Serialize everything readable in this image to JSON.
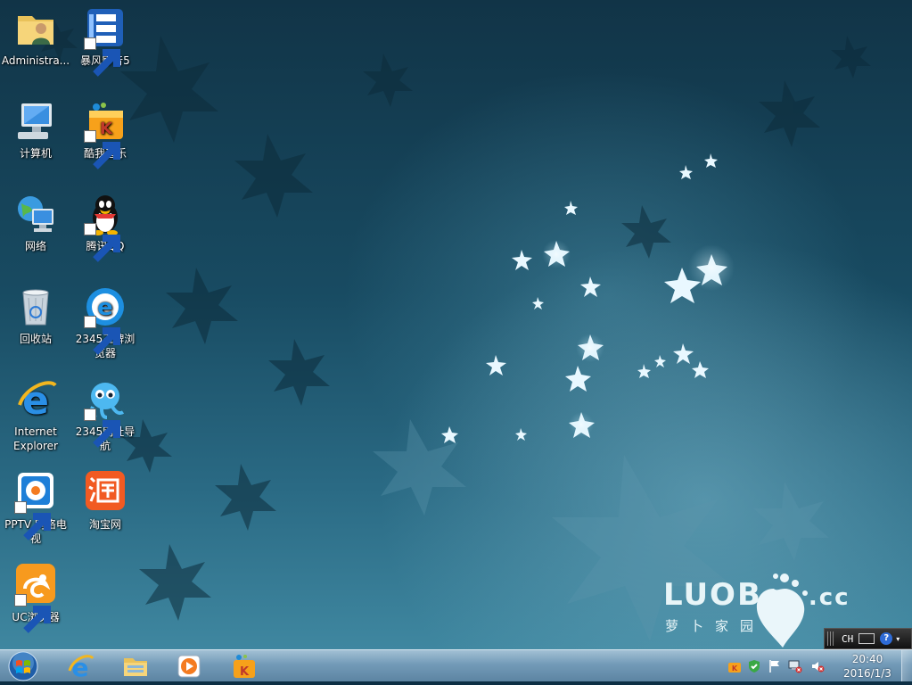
{
  "desktop": {
    "icons": [
      {
        "label": "Administra..."
      },
      {
        "label": "暴风影音5"
      },
      {
        "label": "计算机"
      },
      {
        "label": "酷我音乐"
      },
      {
        "label": "网络"
      },
      {
        "label": "腾讯QQ"
      },
      {
        "label": "回收站"
      },
      {
        "label": "2345王牌浏\n览器"
      },
      {
        "label": "Internet\nExplorer"
      },
      {
        "label": "2345网址导\n航"
      },
      {
        "label": "PPTV 网络电\n视"
      },
      {
        "label": "淘宝网"
      },
      {
        "label": "UC浏览器"
      }
    ],
    "wallpaper_brand": {
      "logo": "LUOB",
      "logo_suffix": ".cc",
      "subtitle": "萝卜家园"
    }
  },
  "langbar": {
    "language": "CH",
    "help": "?"
  },
  "taskbar": {
    "pinned": [
      "internet-explorer-icon",
      "windows-explorer-icon",
      "media-player-icon",
      "kuwo-music-icon"
    ],
    "clock": {
      "time": "20:40",
      "date": "2016/1/3"
    }
  },
  "colors": {
    "taskbar": "#7aa2bf",
    "wallpaper_dark": "#113447",
    "wallpaper_light": "#3f87a0"
  }
}
